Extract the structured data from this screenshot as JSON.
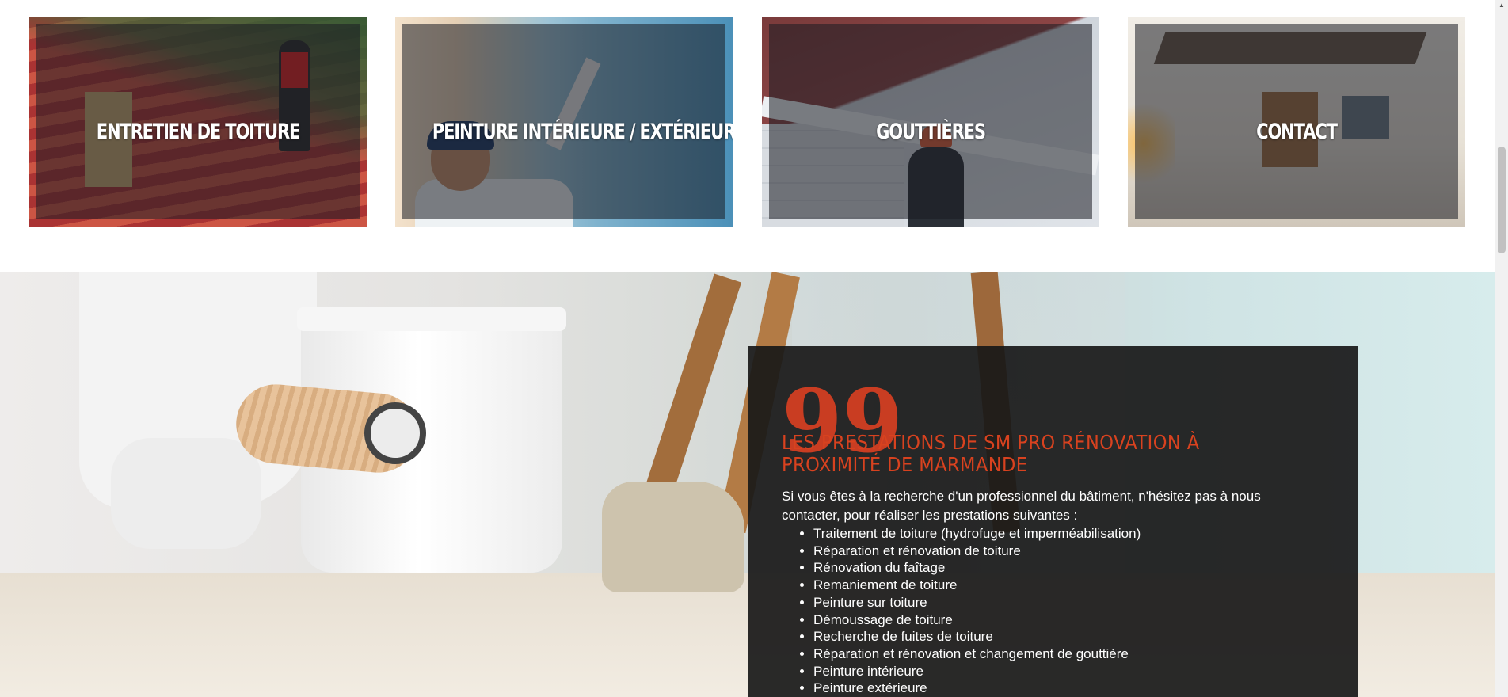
{
  "services": {
    "cards": [
      {
        "label": "ENTRETIEN DE TOITURE"
      },
      {
        "label": "PEINTURE INTÉRIEURE / EXTÉRIEURE"
      },
      {
        "label": "GOUTTIÈRES"
      },
      {
        "label": "CONTACT"
      }
    ]
  },
  "info": {
    "quote_mark": "99",
    "title": "LES PRESTATIONS DE SM PRO RÉNOVATION À PROXIMITÉ DE MARMANDE",
    "intro": "Si vous êtes à la recherche d'un professionnel du bâtiment, n'hésitez pas à nous contacter, pour réaliser les prestations suivantes :",
    "list": [
      "Traitement de toiture (hydrofuge et imperméabilisation)",
      "Réparation et rénovation de toiture",
      "Rénovation du faîtage",
      "Remaniement de toiture",
      "Peinture sur toiture",
      "Démoussage de toiture",
      "Recherche de fuites de toiture",
      "Réparation et rénovation et changement de gouttière",
      "Peinture intérieure",
      "Peinture extérieure"
    ]
  },
  "colors": {
    "accent": "#d8421f",
    "info_bg": "#181818",
    "card_overlay": "#191c22"
  },
  "scrollbar": {
    "up_icon": "▲"
  }
}
